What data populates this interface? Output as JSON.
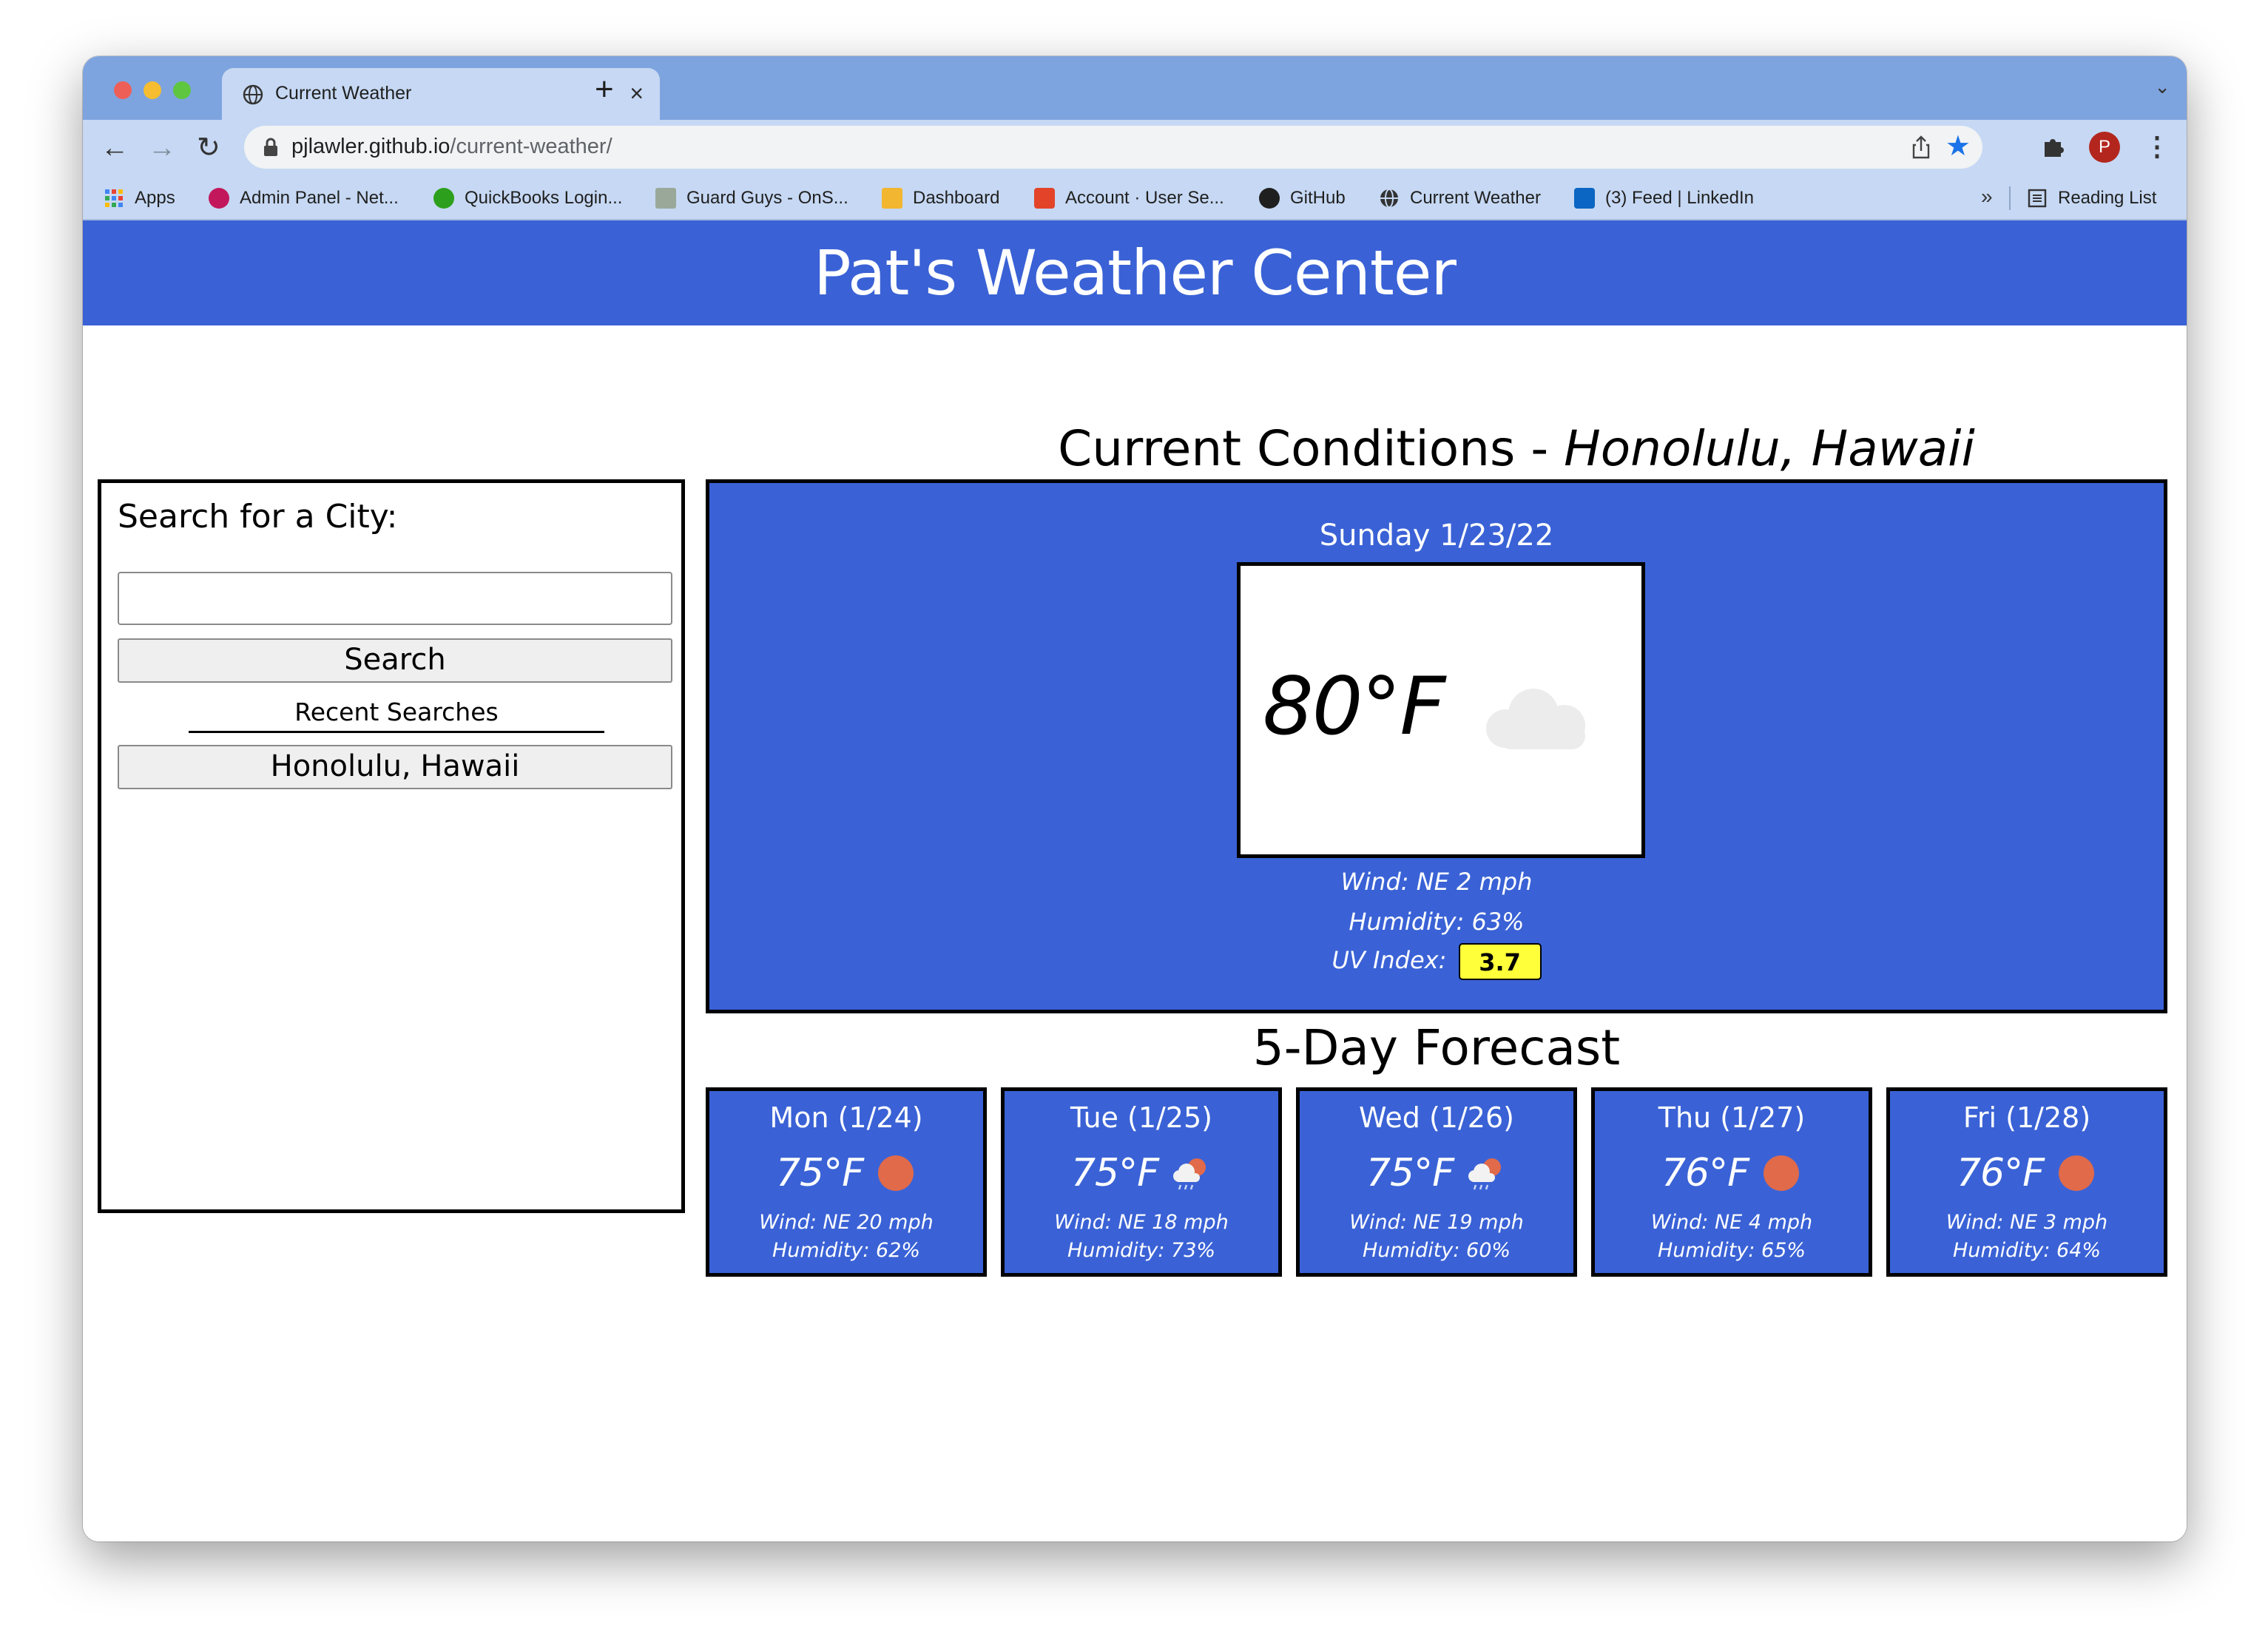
{
  "browser": {
    "tab_title": "Current Weather",
    "url_host": "pjlawler.github.io",
    "url_path": "/current-weather/",
    "profile_initial": "P",
    "bookmarks": [
      {
        "label": "Apps",
        "icon": "apps-grid-icon",
        "color": "#4285f4"
      },
      {
        "label": "Admin Panel - Net...",
        "icon": "admin-panel-icon",
        "color": "#c2185b"
      },
      {
        "label": "QuickBooks Login...",
        "icon": "quickbooks-icon",
        "color": "#2ca01c"
      },
      {
        "label": "Guard Guys - OnS...",
        "icon": "guard-guys-icon",
        "color": "#7a8a7a"
      },
      {
        "label": "Dashboard",
        "icon": "dashboard-icon",
        "color": "#7a0019"
      },
      {
        "label": "Account · User Se...",
        "icon": "gitlab-icon",
        "color": "#e24329"
      },
      {
        "label": "GitHub",
        "icon": "github-icon",
        "color": "#1f1f1f"
      },
      {
        "label": "Current Weather",
        "icon": "globe-icon",
        "color": "#1f1f1f"
      },
      {
        "label": "(3) Feed | LinkedIn",
        "icon": "linkedin-icon",
        "color": "#0a66c2"
      }
    ],
    "more_bookmarks": "»",
    "reading_list": "Reading List"
  },
  "site": {
    "title": "Pat's Weather Center"
  },
  "search": {
    "label": "Search for a City:",
    "input_value": "",
    "button_label": "Search",
    "recent_label": "Recent Searches",
    "recent_items": [
      "Honolulu, Hawaii"
    ]
  },
  "current": {
    "heading_prefix": "Current Conditions - ",
    "city": "Honolulu, Hawaii",
    "date": "Sunday 1/23/22",
    "temp": "80°F",
    "icon": "cloud-icon",
    "wind": "Wind: NE 2 mph",
    "humidity": "Humidity: 63%",
    "uv_label": "UV Index:",
    "uv_value": "3.7",
    "uv_color": "#ffff3a"
  },
  "forecast": {
    "heading": "5-Day Forecast",
    "days": [
      {
        "day": "Mon (1/24)",
        "temp": "75°F",
        "icon": "sun-icon",
        "wind": "Wind: NE 20 mph",
        "humidity": "Humidity: 62%"
      },
      {
        "day": "Tue (1/25)",
        "temp": "75°F",
        "icon": "rain-sun-icon",
        "wind": "Wind: NE 18 mph",
        "humidity": "Humidity: 73%"
      },
      {
        "day": "Wed (1/26)",
        "temp": "75°F",
        "icon": "rain-sun-icon",
        "wind": "Wind: NE 19 mph",
        "humidity": "Humidity: 60%"
      },
      {
        "day": "Thu (1/27)",
        "temp": "76°F",
        "icon": "sun-icon",
        "wind": "Wind: NE 4 mph",
        "humidity": "Humidity: 65%"
      },
      {
        "day": "Fri (1/28)",
        "temp": "76°F",
        "icon": "sun-icon",
        "wind": "Wind: NE 3 mph",
        "humidity": "Humidity: 64%"
      }
    ]
  },
  "colors": {
    "brand_blue": "#3a62d6",
    "sun": "#e06a4a",
    "uv_badge": "#ffff3a"
  }
}
